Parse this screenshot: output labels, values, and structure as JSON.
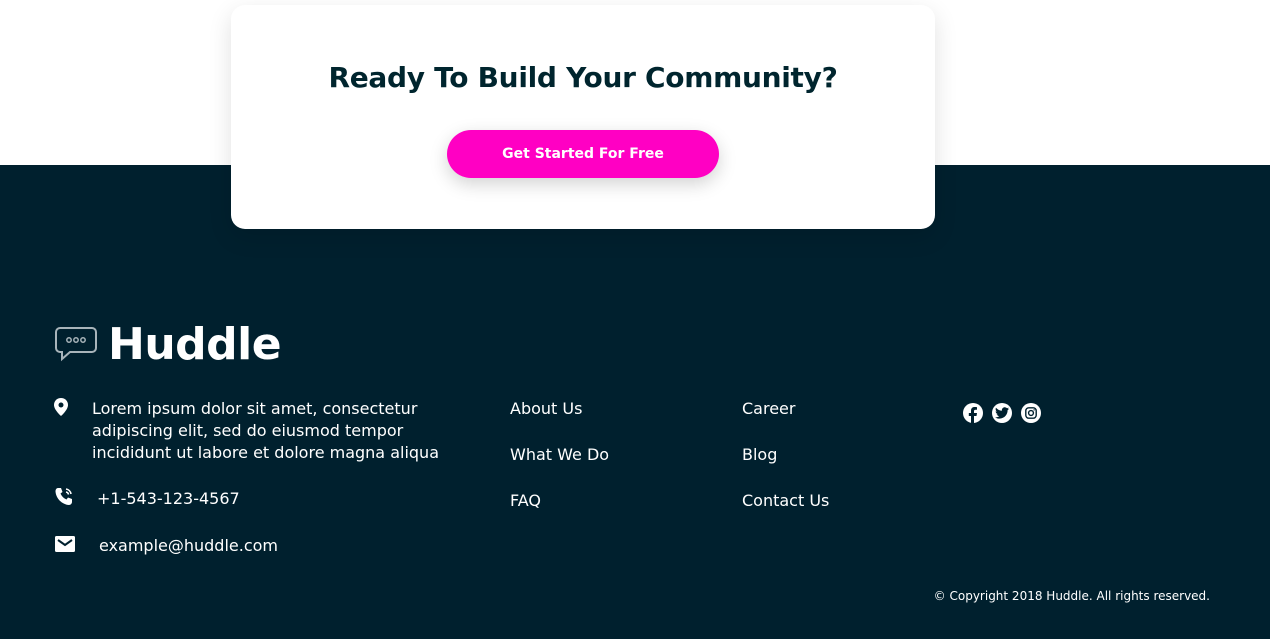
{
  "cta": {
    "title": "Ready To Build Your Community?",
    "button_label": "Get Started For Free"
  },
  "footer": {
    "logo_text": "Huddle",
    "address_lines": [
      "Lorem ipsum dolor sit amet, consectetur",
      "adipiscing elit, sed do eiusmod tempor",
      "incididunt ut labore et dolore magna aliqua"
    ],
    "phone": "+1-543-123-4567",
    "email": "example@huddle.com",
    "links_col1": [
      "About Us",
      "What We Do",
      "FAQ"
    ],
    "links_col2": [
      "Career",
      "Blog",
      "Contact Us"
    ],
    "social_icons": [
      "facebook-icon",
      "twitter-icon",
      "instagram-icon"
    ],
    "copyright": "© Copyright 2018 Huddle. All rights reserved."
  },
  "colors": {
    "footer_bg": "#00202e",
    "accent": "#ff00c3",
    "text_light": "#ffffff",
    "heading_dark": "#00252e"
  }
}
